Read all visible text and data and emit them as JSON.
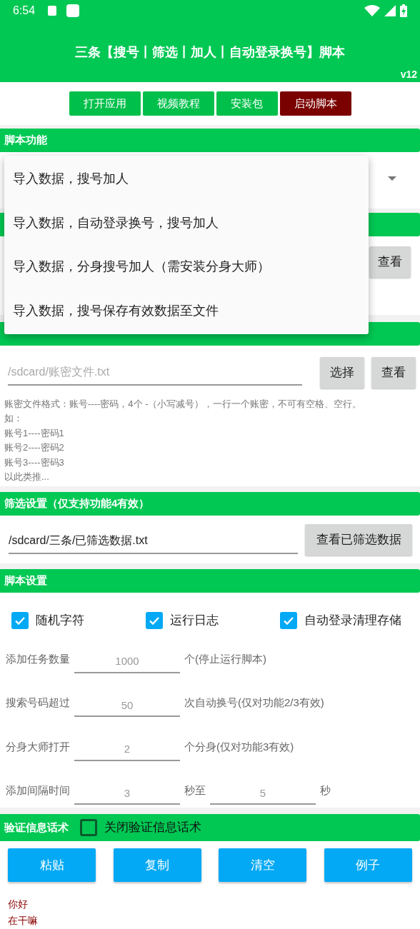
{
  "status_bar": {
    "time": "6:54"
  },
  "header": {
    "title": "三条【搜号丨筛选丨加人丨自动登录换号】脚本",
    "version": "v12"
  },
  "top_buttons": [
    {
      "label": "打开应用",
      "kind": "primary"
    },
    {
      "label": "视频教程",
      "kind": "primary"
    },
    {
      "label": "安装包",
      "kind": "primary"
    },
    {
      "label": "启动脚本",
      "kind": "danger"
    }
  ],
  "function_section": {
    "title": "脚本功能",
    "dropdown_options": [
      "导入数据，搜号加人",
      "导入数据，自动登录换号，搜号加人",
      "导入数据，分身搜号加人（需安装分身大师）",
      "导入数据，搜号保存有效数据至文件"
    ],
    "covered_row_button": "查看"
  },
  "account_section": {
    "placeholder": "/sdcard/账密文件.txt",
    "buttons": [
      "选择",
      "查看"
    ],
    "help_lines": [
      "账密文件格式：账号----密码，4个 -（小写减号），一行一个账密，不可有空格、空行。",
      "如：",
      "账号1----密码1",
      "账号2----密码2",
      "账号3----密码3",
      "以此类推..."
    ]
  },
  "filter_section": {
    "title": "筛选设置（仅支持功能4有效）",
    "value": "/sdcard/三条/已筛选数据.txt",
    "button": "查看已筛选数据"
  },
  "script_settings": {
    "title": "脚本设置",
    "checkboxes": [
      {
        "label": "随机字符",
        "checked": true
      },
      {
        "label": "运行日志",
        "checked": true
      },
      {
        "label": "自动登录清理存储",
        "checked": true
      }
    ],
    "rows": [
      {
        "parts": [
          {
            "kind": "label",
            "text": "添加任务数量"
          },
          {
            "kind": "field",
            "placeholder": "1000"
          },
          {
            "kind": "label",
            "text": "个(停止运行脚本)"
          }
        ]
      },
      {
        "parts": [
          {
            "kind": "label",
            "text": "搜索号码超过"
          },
          {
            "kind": "field",
            "placeholder": "50"
          },
          {
            "kind": "label",
            "text": "次自动换号(仅对功能2/3有效)"
          }
        ]
      },
      {
        "parts": [
          {
            "kind": "label",
            "text": "分身大师打开"
          },
          {
            "kind": "field",
            "placeholder": "2"
          },
          {
            "kind": "label",
            "text": "个分身(仅对功能3有效)"
          }
        ]
      },
      {
        "parts": [
          {
            "kind": "label",
            "text": "添加间隔时间"
          },
          {
            "kind": "field",
            "placeholder": "3"
          },
          {
            "kind": "label",
            "text": "秒至"
          },
          {
            "kind": "field",
            "placeholder": "5"
          },
          {
            "kind": "label",
            "text": "秒"
          }
        ]
      }
    ]
  },
  "verify_section": {
    "title": "验证信息话术",
    "toggle": {
      "label": "关闭验证信息话术",
      "checked": false
    },
    "buttons": [
      "粘贴",
      "复制",
      "清空",
      "例子"
    ],
    "messages": [
      "你好",
      "在干嘛"
    ]
  }
}
